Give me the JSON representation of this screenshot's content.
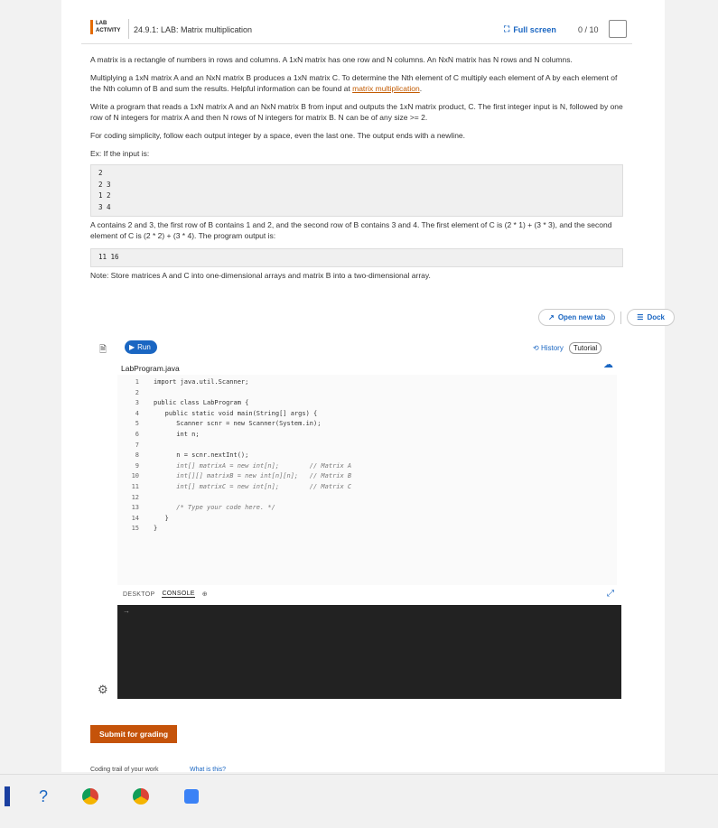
{
  "header": {
    "badge_line1": "LAB",
    "badge_line2": "ACTIVITY",
    "title": "24.9.1: LAB: Matrix multiplication",
    "fullscreen_label": "Full screen",
    "score": "0 / 10"
  },
  "instructions": {
    "p1": "A matrix is a rectangle of numbers in rows and columns. A 1xN matrix has one row and N columns. An NxN matrix has N rows and N columns.",
    "p2_text": "Multiplying a 1xN matrix A and an NxN matrix B produces a 1xN matrix C. To determine the Nth element of C multiply each element of A by each element of the Nth column of B and sum the results. Helpful information can be found at ",
    "p2_link": "matrix multiplication",
    "p2_end": ".",
    "p3": "Write a program that reads a 1xN matrix A and an NxN matrix B from input and outputs the 1xN matrix product, C. The first integer input is N, followed by one row of N integers for matrix A and then N rows of N integers for matrix B. N can be of any size >= 2.",
    "p4": "For coding simplicity, follow each output integer by a space, even the last one. The output ends with a newline.",
    "p5": "Ex: If the input is:",
    "example_input": "2\n2 3\n1 2\n3 4",
    "p6": "A contains 2 and 3, the first row of B contains 1 and 2, and the second row of B contains 3 and 4. The first element of C is (2 * 1) + (3 * 3), and the second element of C is (2 * 2) + (3 * 4). The program output is:",
    "example_output": "11 16",
    "p7": "Note: Store matrices A and C into one-dimensional arrays and matrix B into a two-dimensional array."
  },
  "toolbar": {
    "open_tab": "Open new tab",
    "dock": "Dock",
    "run": "Run",
    "history": "History",
    "tutorial": "Tutorial"
  },
  "editor": {
    "filename": "LabProgram.java",
    "line_numbers": [
      "1",
      "2",
      "3",
      "4",
      "5",
      "6",
      "7",
      "8",
      "9",
      "10",
      "11",
      "12",
      "13",
      "14",
      "15"
    ],
    "lines": [
      "import java.util.Scanner;",
      "",
      "public class LabProgram {",
      "   public static void main(String[] args) {",
      "      Scanner scnr = new Scanner(System.in);",
      "      int n;",
      "",
      "      n = scnr.nextInt();",
      "      int[] matrixA = new int[n];        // Matrix A",
      "      int[][] matrixB = new int[n][n];   // Matrix B",
      "      int[] matrixC = new int[n];        // Matrix C",
      "",
      "      /* Type your code here. */",
      "   }",
      "}"
    ]
  },
  "console_tabs": {
    "desktop": "DESKTOP",
    "console": "CONSOLE",
    "prompt": "→"
  },
  "footer": {
    "submit": "Submit for grading",
    "trail": "Coding trail of your work",
    "whatis": "What is this?"
  },
  "colors": {
    "accent": "#1a66c2",
    "submit": "#c5530a",
    "console_bg": "#222222"
  }
}
